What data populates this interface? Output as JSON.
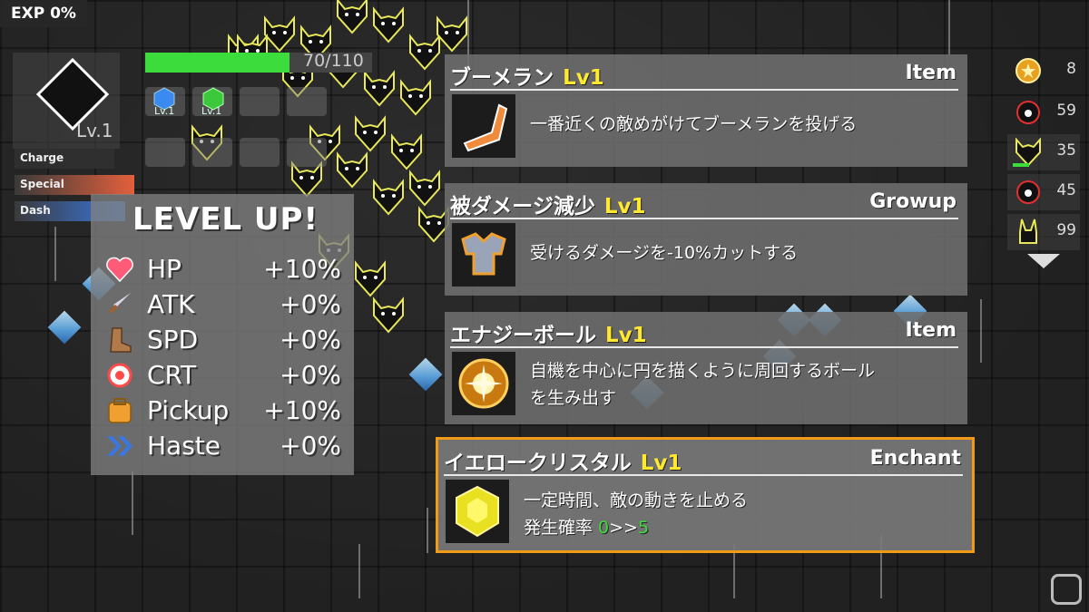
{
  "hud": {
    "exp_label": "EXP 0%",
    "level_label": "Lv.1",
    "hp_text": "70/110",
    "hp_fraction": 0.636,
    "slots": [
      {
        "icon": "blue-gem-icon",
        "label": "Lv.1"
      },
      {
        "icon": "green-gem-icon",
        "label": "Lv.1"
      }
    ],
    "gauges": [
      {
        "label": "Charge",
        "color": "#2f2f2f"
      },
      {
        "label": "Special",
        "color": "#e2603c"
      },
      {
        "label": "Dash",
        "color": "#3a78e0"
      }
    ]
  },
  "level_up": {
    "title": "LEVEL UP!",
    "stats": [
      {
        "name": "HP",
        "value": "+10%",
        "icon": "heart-icon",
        "color": "#ff5a78"
      },
      {
        "name": "ATK",
        "value": "+0%",
        "icon": "sword-icon",
        "color": "#c8c8d8"
      },
      {
        "name": "SPD",
        "value": "+0%",
        "icon": "boot-icon",
        "color": "#b07a4a"
      },
      {
        "name": "CRT",
        "value": "+0%",
        "icon": "crosshair-icon",
        "color": "#ff4a4a"
      },
      {
        "name": "Pickup",
        "value": "+10%",
        "icon": "backpack-icon",
        "color": "#f0a030"
      },
      {
        "name": "Haste",
        "value": "+0%",
        "icon": "chevrons-icon",
        "color": "#3a78e0"
      }
    ]
  },
  "choices": [
    {
      "name": "ブーメラン",
      "level": "Lv1",
      "type": "Item",
      "icon": "boomerang-icon",
      "desc": [
        "一番近くの敵めがけてブーメランを投げる"
      ]
    },
    {
      "name": "被ダメージ減少",
      "level": "Lv1",
      "type": "Growup",
      "icon": "armor-icon",
      "desc": [
        "受けるダメージを-10%カットする"
      ]
    },
    {
      "name": "エナジーボール",
      "level": "Lv1",
      "type": "Item",
      "icon": "energy-ball-icon",
      "desc": [
        "自機を中心に円を描くように周回するボール",
        "を生み出す"
      ]
    },
    {
      "name": "イエロークリスタル",
      "level": "Lv1",
      "type": "Enchant",
      "icon": "yellow-crystal-icon",
      "desc": [
        "一定時間、敵の動きを止める"
      ],
      "rate_label": "発生確率 ",
      "rate_from": "0",
      "rate_arrow": ">>",
      "rate_to": "5",
      "selected": true
    }
  ],
  "enemies": [
    {
      "icon": "coin-icon",
      "count": "8"
    },
    {
      "icon": "red-eye-creature-icon",
      "count": "59"
    },
    {
      "icon": "wolf-icon",
      "count": "35"
    },
    {
      "icon": "red-eye-creature-icon",
      "count": "45"
    },
    {
      "icon": "rabbit-icon",
      "count": "99"
    }
  ],
  "colors": {
    "accent": "#f09a18",
    "level": "#ffe830",
    "hp": "#3cdc3c",
    "rate": "#3cdc3c"
  }
}
